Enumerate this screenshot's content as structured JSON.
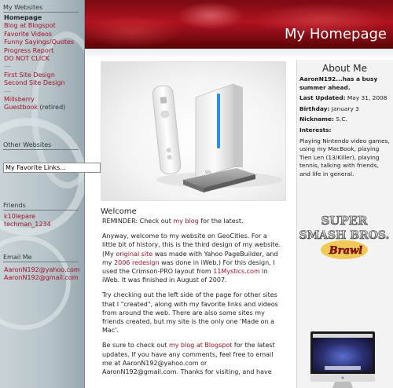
{
  "header": {
    "title": "My Homepage"
  },
  "sidebar": {
    "my_websites": {
      "heading": "My Websites",
      "items": [
        {
          "label": "Homepage",
          "kind": "current"
        },
        {
          "label": "Blog at Blogspot",
          "kind": "link"
        },
        {
          "label": "Favorite Videos",
          "kind": "link"
        },
        {
          "label": "Funny Sayings/Quotes",
          "kind": "link"
        },
        {
          "label": "Progress Report",
          "kind": "link"
        },
        {
          "label": "DO NOT CLICK",
          "kind": "link"
        },
        {
          "label": "---",
          "kind": "sep"
        },
        {
          "label": "First Site Design",
          "kind": "link"
        },
        {
          "label": "Second Site Design",
          "kind": "link"
        },
        {
          "label": "---",
          "kind": "sep"
        },
        {
          "label": "Millsberry",
          "kind": "link"
        },
        {
          "label": "Guestbook",
          "kind": "link",
          "suffix": " (retired)"
        }
      ]
    },
    "other_websites": {
      "heading": "Other Websites",
      "select_value": "My Favorite Links..."
    },
    "friends": {
      "heading": "Friends",
      "items": [
        "k10lepare",
        "techman_1234"
      ]
    },
    "email": {
      "heading": "Email Me",
      "items": [
        "AaronN192@yahoo.com",
        "AaronN192@gmail.com"
      ]
    }
  },
  "main": {
    "welcome_title": "Welcome",
    "p1": {
      "a": "REMINDER: Check out ",
      "link": "my blog",
      "b": " for the latest."
    },
    "p2": {
      "a": "Anyway, welcome to my website on GeoCities. For a little bit of history, this is the third design of my website. (My ",
      "link1": "original site",
      "b": " was made with Yahoo PageBuilder, and my ",
      "link2": "2006 redesign",
      "c": " was done in iWeb.) For this design, I used the Crimson-PRO layout from ",
      "link3": "11Mystics.com",
      "d": " in iWeb. It was finished in August of 2007."
    },
    "p3": "Try checking out the left side of the page for other sites that I \"created\", along with my favorite links and videos from around the web. There are also some sites my friends created, but my site is the only one 'Made on a Mac'.",
    "p4": {
      "a": "Be sure to check out ",
      "link": "my blog at Blogspot",
      "b": " for the latest updates. If you have any comments, feel free to email me at AaronN192@yahoo.com or AaronN192@gmail.com. Thanks for visiting, and have"
    }
  },
  "about": {
    "title": "About Me",
    "tagline": "AaronN192...has a busy summer ahead.",
    "last_updated_label": "Last Updated:",
    "last_updated": "May 31, 2008",
    "birthday_label": "Birthday:",
    "birthday": "January 3",
    "nickname_label": "Nickname:",
    "nickname": "S.C.",
    "interests_label": "Interests:",
    "interests": "Playing Nintendo video games, using my MacBook, playing Tien Len (13/Killer), playing tennis, talking with friends, and life in general."
  },
  "logo": {
    "line1": "SUPER",
    "line2": "SMASH BROS.",
    "line3": "Brawl"
  },
  "wii_label": "Wii",
  "colors": {
    "accent": "#a0112a",
    "header_red": "#b0131f"
  }
}
